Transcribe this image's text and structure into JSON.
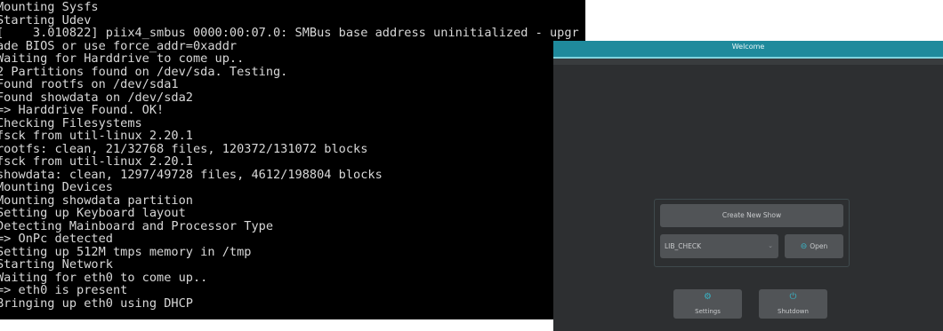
{
  "console": {
    "lines": [
      "Mounting Sysfs",
      "Starting Udev",
      "[    3.010822] piix4_smbus 0000:00:07.0: SMBus base address uninitialized - upgr",
      "ade BIOS or use force_addr=0xaddr",
      "Waiting for Harddrive to come up..",
      "2 Partitions found on /dev/sda. Testing.",
      "Found rootfs on /dev/sda1",
      "Found showdata on /dev/sda2",
      "=> Harddrive Found. OK!",
      "Checking Filesystems",
      "fsck from util-linux 2.20.1",
      "rootfs: clean, 21/32768 files, 120372/131072 blocks",
      "fsck from util-linux 2.20.1",
      "showdata: clean, 1297/49728 files, 4612/198804 blocks",
      "Mounting Devices",
      "Mounting showdata partition",
      "Setting up Keyboard layout",
      "Detecting Mainboard and Processor Type",
      "=> OnPc detected",
      "Setting up 512M tmps memory in /tmp",
      "Starting Network",
      "Waiting for eth0 to come up..",
      "=> eth0 is present",
      "Bringing up eth0 using DHCP"
    ]
  },
  "app": {
    "title": "Welcome",
    "create_label": "Create New Show",
    "show_select_value": "LIB_CHECK",
    "open_label": "Open",
    "settings_label": "Settings",
    "shutdown_label": "Shutdown",
    "icons": {
      "open": "open-icon",
      "settings": "gear-icon",
      "shutdown": "power-icon",
      "dropdown": "chevron-down-icon"
    },
    "colors": {
      "accent": "#39b3c5",
      "titlebar": "#1f8a9c",
      "background": "#2d2f31"
    }
  }
}
